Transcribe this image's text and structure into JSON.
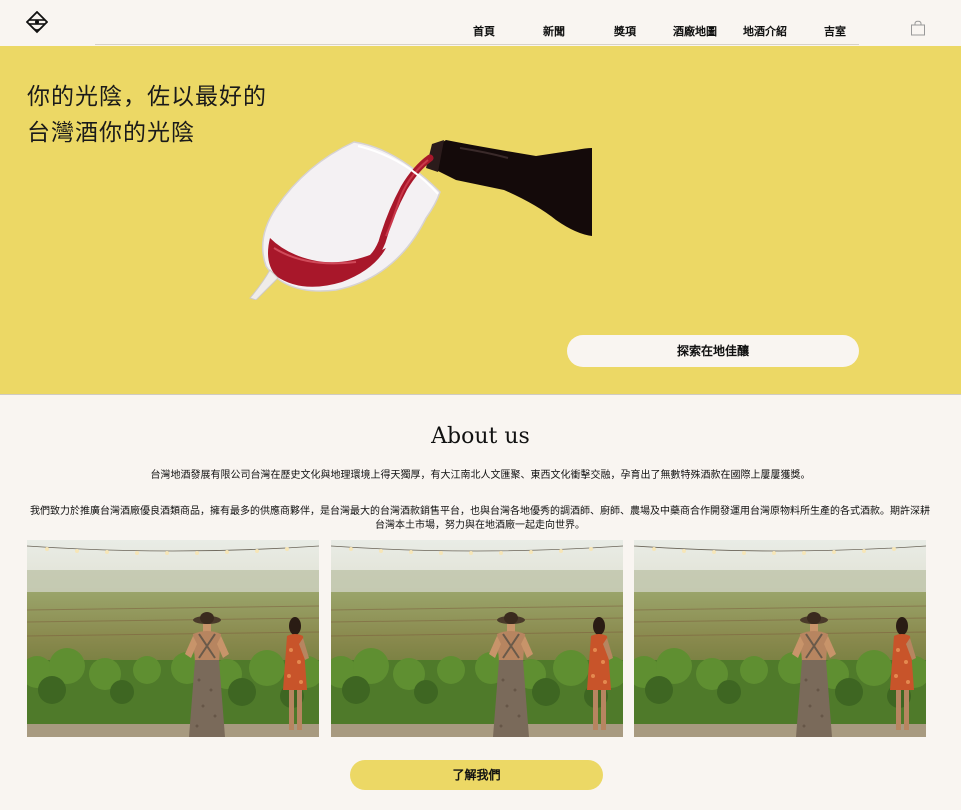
{
  "nav": {
    "items": [
      {
        "label": "首頁"
      },
      {
        "label": "新聞"
      },
      {
        "label": "獎項"
      },
      {
        "label": "酒廠地圖"
      },
      {
        "label": "地酒介紹"
      },
      {
        "label": "吉室"
      }
    ]
  },
  "hero": {
    "line1": "你的光陰，佐以最好的",
    "line2": "台灣酒你的光陰",
    "button_label": "探索在地佳釀"
  },
  "about": {
    "title": "About us",
    "paragraph1": "台灣地酒發展有限公司台灣在歷史文化與地理環境上得天獨厚，有大江南北人文匯聚、東西文化衝擊交融，孕育出了無數特殊酒款在國際上屢屢獲獎。",
    "paragraph2": "我們致力於推廣台灣酒廠優良酒類商品，擁有最多的供應商夥伴，是台灣最大的台灣酒款銷售平台，也與台灣各地優秀的調酒師、廚師、農場及中藥商合作開發運用台灣原物料所生產的各式酒款。期許深耕台灣本土市場，努力與在地酒廠一起走向世界。",
    "button_label": "了解我們"
  },
  "colors": {
    "accent": "#ecd865",
    "background": "#f9f5f1",
    "wine": "#b01e2e"
  },
  "icons": [
    "logo-icon",
    "shopping-bag-icon"
  ]
}
